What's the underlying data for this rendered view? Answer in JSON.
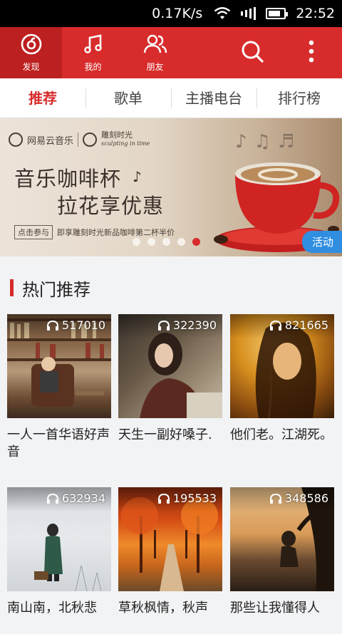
{
  "status_bar": {
    "network_speed": "0.17K/s",
    "time": "22:52"
  },
  "top_nav": {
    "tabs": [
      {
        "label": "发现",
        "icon": "netease-music-logo-icon",
        "active": true
      },
      {
        "label": "我的",
        "icon": "music-note-icon",
        "active": false
      },
      {
        "label": "朋友",
        "icon": "friends-icon",
        "active": false
      }
    ],
    "actions": [
      {
        "icon": "search-icon"
      },
      {
        "icon": "more-vertical-icon"
      }
    ],
    "colors": {
      "bar": "#d72c2b",
      "active": "#bd2020"
    }
  },
  "sub_tabs": [
    {
      "label": "推荐",
      "active": true
    },
    {
      "label": "歌单",
      "active": false
    },
    {
      "label": "主播电台",
      "active": false
    },
    {
      "label": "排行榜",
      "active": false
    }
  ],
  "banner": {
    "brand_left": "网易云音乐",
    "brand_right": "雕刻时光",
    "brand_right_sub": "sculpting in time",
    "headline_1": "音乐咖啡杯",
    "headline_2": "拉花享优惠",
    "cta_button": "点击参与",
    "cta_text": "即享雕刻时光新品咖啡第二杯半价",
    "tag": "活动",
    "dots": 5,
    "active_dot": 5
  },
  "section": {
    "title": "热门推荐"
  },
  "playlists": [
    {
      "name": "一人一首华语好声音",
      "play_count": "517010",
      "theme": "bookshelf"
    },
    {
      "name": "天生一副好嗓子.",
      "play_count": "322390",
      "theme": "woman-portrait"
    },
    {
      "name": "他们老。江湖死。",
      "play_count": "821665",
      "theme": "golden-portrait"
    },
    {
      "name": "南山南，北秋悲",
      "play_count": "632934",
      "theme": "snow-figure"
    },
    {
      "name": "草秋枫情，秋声",
      "play_count": "195533",
      "theme": "autumn-road"
    },
    {
      "name": "那些让我懂得人",
      "play_count": "348586",
      "theme": "beach-sunset"
    }
  ]
}
